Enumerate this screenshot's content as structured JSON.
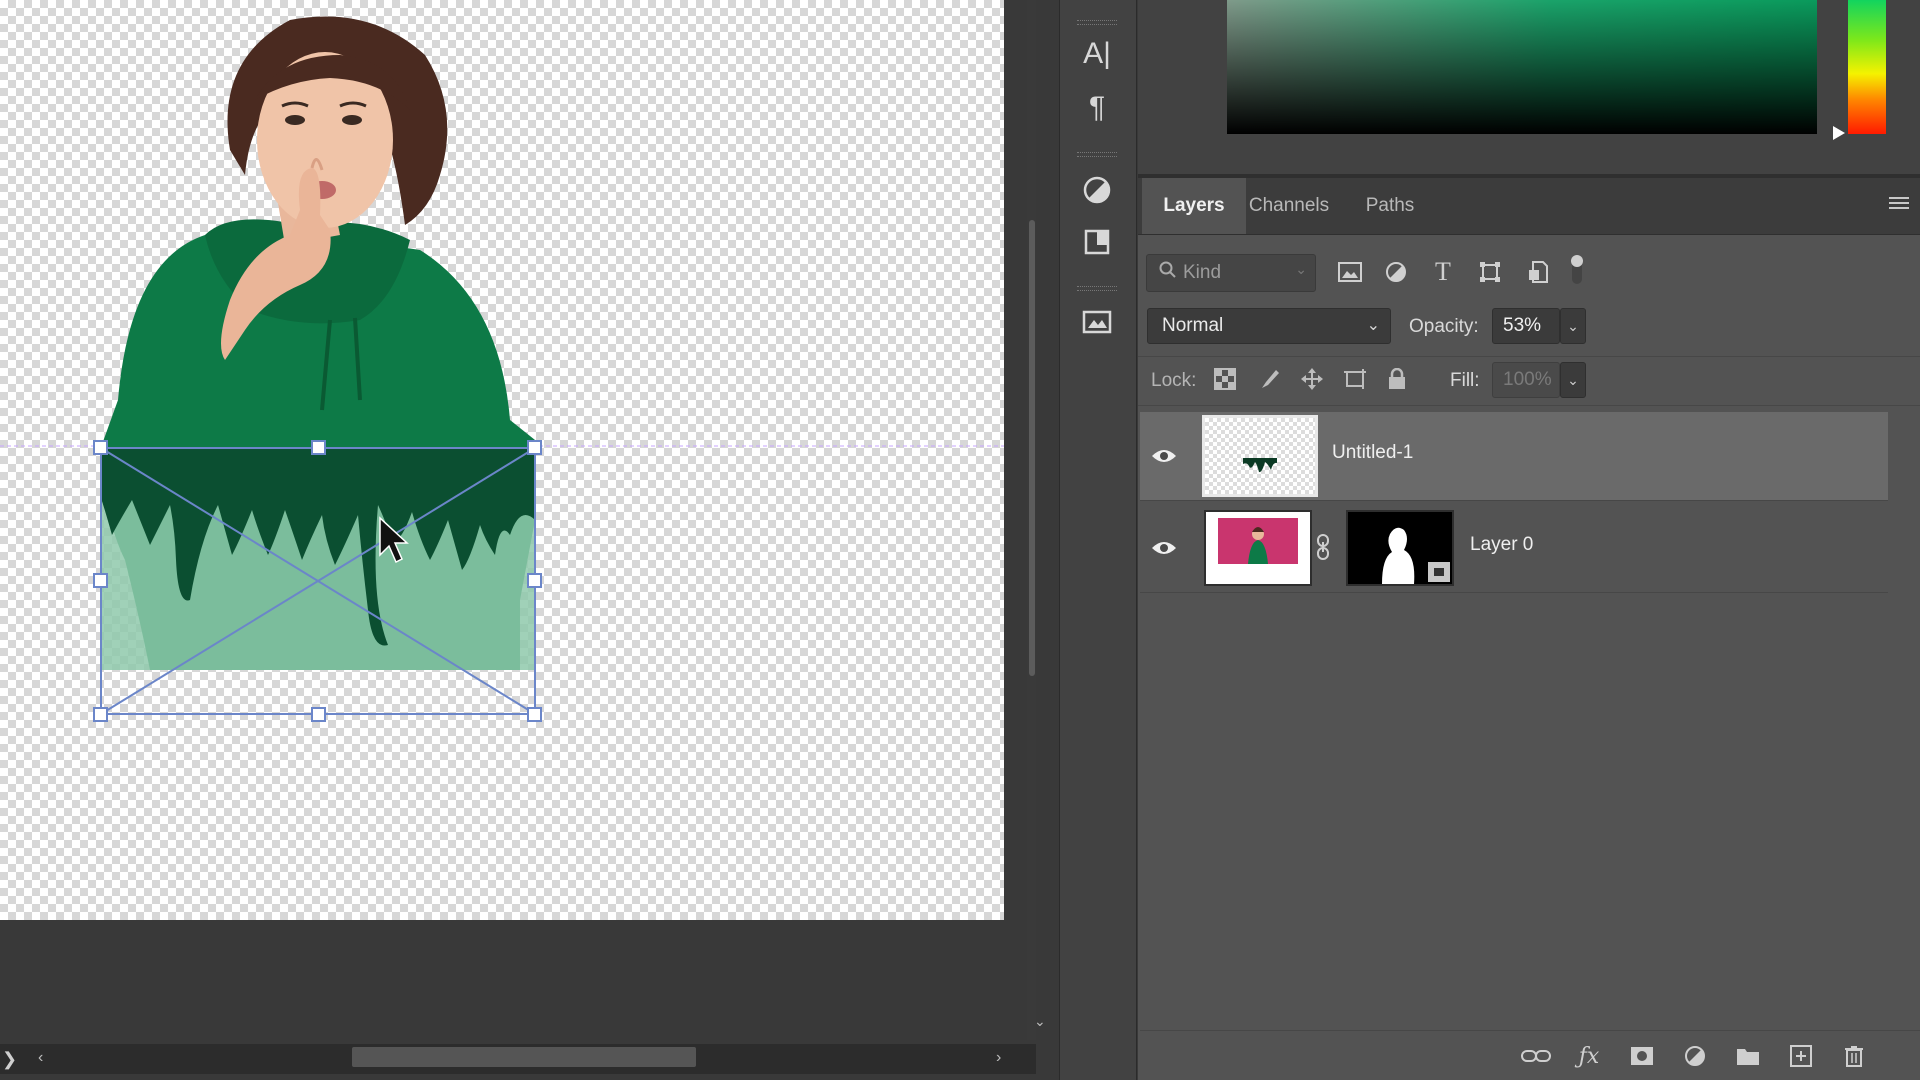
{
  "panel": {
    "tabs": [
      {
        "label": "Layers",
        "active": true
      },
      {
        "label": "Channels",
        "active": false
      },
      {
        "label": "Paths",
        "active": false
      }
    ],
    "filter": {
      "placeholder": "Kind"
    },
    "blend_mode": "Normal",
    "opacity_label": "Opacity:",
    "opacity_value": "53%",
    "lock_label": "Lock:",
    "fill_label": "Fill:",
    "fill_value": "100%"
  },
  "layers": [
    {
      "name": "Untitled-1",
      "selected": true,
      "visible": true
    },
    {
      "name": "Layer 0",
      "selected": false,
      "visible": true,
      "has_mask": true
    }
  ],
  "colors": {
    "accent_green": "#0a7a45",
    "selection_box": "#6b86c9",
    "panel_bg": "#535353",
    "selected_row": "#6a6a6a"
  },
  "icons": {
    "tools": [
      "character-icon",
      "paragraph-icon",
      "adjustments-icon",
      "swatch-library-icon",
      "image-frame-icon"
    ],
    "filters": [
      "image-filter-icon",
      "adjustment-filter-icon",
      "type-filter-icon",
      "shape-filter-icon",
      "smart-object-filter-icon"
    ],
    "locks": [
      "lock-transparent-icon",
      "lock-pixels-icon",
      "lock-position-icon",
      "lock-artboard-icon",
      "lock-all-icon"
    ],
    "bottom": [
      "link-layers-icon",
      "fx-icon",
      "add-mask-icon",
      "new-adjustment-icon",
      "new-group-icon",
      "new-layer-icon",
      "delete-layer-icon"
    ]
  }
}
